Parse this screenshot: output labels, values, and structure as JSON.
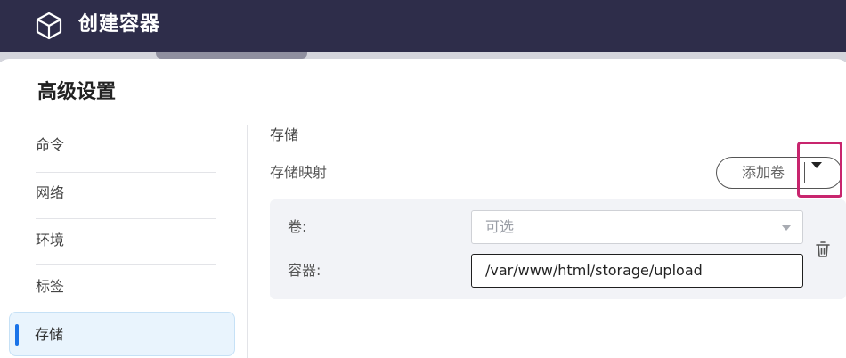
{
  "window": {
    "title": "创建容器",
    "icon": "cube-icon"
  },
  "page": {
    "section_title": "高级设置"
  },
  "sidebar": {
    "items": [
      {
        "label": "命令"
      },
      {
        "label": "网络"
      },
      {
        "label": "环境"
      },
      {
        "label": "标签"
      },
      {
        "label": "存储",
        "active": true
      }
    ]
  },
  "storage": {
    "heading": "存储",
    "mapping_label": "存储映射",
    "add_volume_label": "添加卷",
    "dropdown_icon": "caret-down-icon",
    "rows": [
      {
        "volume_label": "卷:",
        "volume_value": "可选",
        "container_label": "容器:",
        "container_value": "/var/www/html/storage/upload",
        "delete_icon": "trash-icon"
      }
    ]
  },
  "colors": {
    "titlebar": "#2e2d4a",
    "accent": "#1a73e8",
    "active_item_bg": "#e9f4fd",
    "highlight_border": "#c8256e",
    "panel_bg": "#f2f3f7"
  }
}
